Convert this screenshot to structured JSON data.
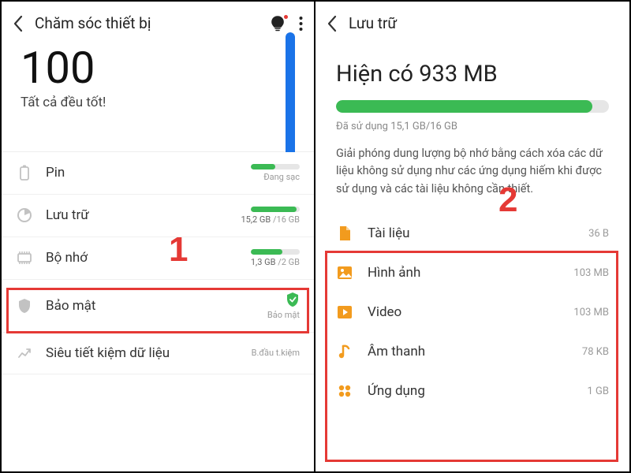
{
  "left": {
    "title": "Chăm sóc thiết bị",
    "score": "100",
    "score_sub": "Tất cả đều tốt!",
    "items": [
      {
        "label": "Pin",
        "status": "Đang sạc",
        "bar_pct": 50
      },
      {
        "label": "Lưu trữ",
        "used": "15,2 GB",
        "total": "/16 GB",
        "bar_pct": 94
      },
      {
        "label": "Bộ nhớ",
        "used": "1,3 GB",
        "total": "/2 GB",
        "bar_pct": 65
      },
      {
        "label": "Bảo mật",
        "status": "Bảo mật"
      },
      {
        "label": "Siêu tiết kiệm dữ liệu",
        "status": "B.đầu t.kiệm"
      }
    ],
    "annotation": "1"
  },
  "right": {
    "title": "Lưu trữ",
    "headline": "Hiện có 933 MB",
    "used_text": "Đã sử dụng 15,1 GB/16 GB",
    "bar_pct": 94,
    "description": "Giải phóng dung lượng bộ nhớ bằng cách xóa các dữ liệu không sử dụng như các ứng dụng hiếm khi được sử dụng và các tài liệu không cần thiết.",
    "categories": [
      {
        "icon": "doc",
        "label": "Tài liệu",
        "size": "36 B"
      },
      {
        "icon": "image",
        "label": "Hình ảnh",
        "size": "103 MB"
      },
      {
        "icon": "video",
        "label": "Video",
        "size": "103 MB"
      },
      {
        "icon": "audio",
        "label": "Âm thanh",
        "size": "78 KB"
      },
      {
        "icon": "apps",
        "label": "Ứng dụng",
        "size": "1 GB"
      }
    ],
    "annotation": "2"
  },
  "colors": {
    "accent": "#f29b1e",
    "green": "#3bba54",
    "red": "#e53935",
    "blue": "#1a73e8"
  }
}
